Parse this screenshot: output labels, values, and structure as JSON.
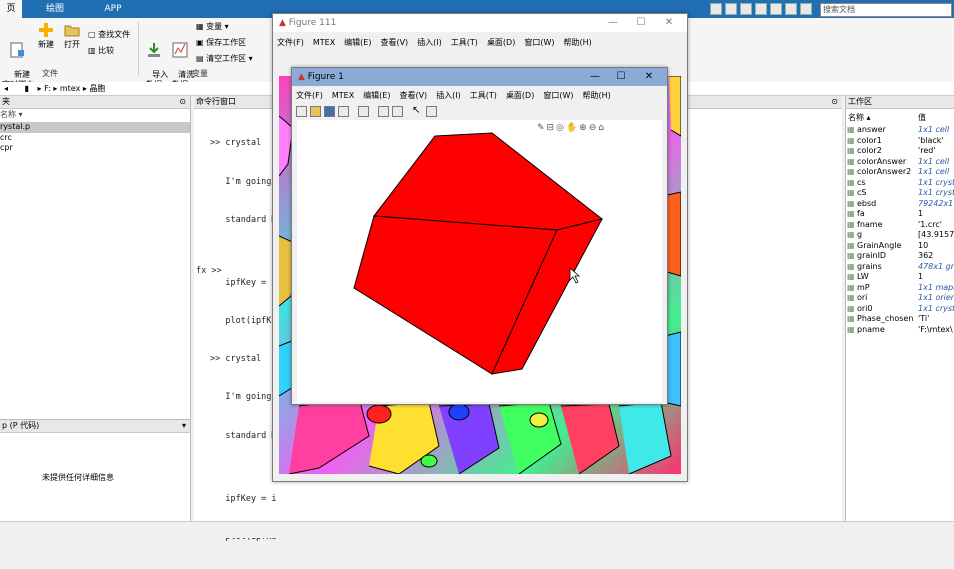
{
  "ribbon": {
    "tabs": [
      "页",
      "绘图",
      "APP"
    ],
    "groups": {
      "file": "文件",
      "variable": "变量"
    },
    "buttons": {
      "new_script": "新建\n实时脚本",
      "new": "新建",
      "open": "打开",
      "find_files": "查找文件",
      "compare": "比较",
      "import_data": "导入\n数据",
      "clean_data": "清洗\n数据",
      "variable": "变量",
      "save_workspace": "保存工作区",
      "clear_workspace": "清空工作区"
    },
    "search_placeholder": "搜索文档"
  },
  "address": {
    "path": [
      "F:",
      "mtex",
      "晶胞"
    ]
  },
  "file_panel": {
    "title": "夹",
    "column": "名称",
    "files": [
      "rystal.p",
      "crc",
      "cpr"
    ]
  },
  "detail_panel": {
    "title": "p (P 代码)",
    "message": "未提供任何详细信息"
  },
  "command_window": {
    "title": "命令行窗口",
    "lines": [
      ">> crystal",
      "   I'm going",
      "   standard M",
      "",
      "   ipfKey = i",
      "   plot(ipfKe",
      ">> crystal",
      "   I'm going",
      "   standard M",
      "",
      "   ipfKey = i",
      "   plot(ipfKe"
    ],
    "prompt": "fx >>"
  },
  "workspace": {
    "title": "工作区",
    "col_name": "名称",
    "col_value": "值",
    "vars": [
      {
        "name": "answer",
        "value": "1x1 cell",
        "italic": true
      },
      {
        "name": "color1",
        "value": "'black'",
        "italic": false
      },
      {
        "name": "color2",
        "value": "'red'",
        "italic": false
      },
      {
        "name": "colorAnswer",
        "value": "1x1 cell",
        "italic": true
      },
      {
        "name": "colorAnswer2",
        "value": "1x1 cell",
        "italic": true
      },
      {
        "name": "cs",
        "value": "1x1 crysta",
        "italic": true
      },
      {
        "name": "cS",
        "value": "1x1 crysta",
        "italic": true
      },
      {
        "name": "ebsd",
        "value": "79242x1 e",
        "italic": true
      },
      {
        "name": "fa",
        "value": "1",
        "italic": false
      },
      {
        "name": "fname",
        "value": "'1.crc'",
        "italic": false
      },
      {
        "name": "g",
        "value": "[43.9157,4",
        "italic": false
      },
      {
        "name": "GrainAngle",
        "value": "10",
        "italic": false
      },
      {
        "name": "grainID",
        "value": "362",
        "italic": false
      },
      {
        "name": "grains",
        "value": "478x1 gra",
        "italic": true
      },
      {
        "name": "LW",
        "value": "1",
        "italic": false
      },
      {
        "name": "mP",
        "value": "1x1 mapP",
        "italic": true
      },
      {
        "name": "ori",
        "value": "1x1 orien",
        "italic": true
      },
      {
        "name": "ori0",
        "value": "1x1 crysta",
        "italic": true
      },
      {
        "name": "Phase_chosen",
        "value": "'Ti'",
        "italic": false
      },
      {
        "name": "pname",
        "value": "'F:\\mtex\\",
        "italic": false
      }
    ]
  },
  "figure111": {
    "title": "Figure 111",
    "menu": [
      "文件(F)",
      "MTEX",
      "编辑(E)",
      "查看(V)",
      "插入(I)",
      "工具(T)",
      "桌面(D)",
      "窗口(W)",
      "帮助(H)"
    ]
  },
  "figure1": {
    "title": "Figure 1",
    "menu": [
      "文件(F)",
      "MTEX",
      "编辑(E)",
      "查看(V)",
      "插入(I)",
      "工具(T)",
      "桌面(D)",
      "窗口(W)",
      "帮助(H)"
    ]
  },
  "colors": {
    "ribbon_blue": "#1f6fb2",
    "figure1_titlebar": "#8aaad8",
    "crystal_red": "#ff0000"
  }
}
